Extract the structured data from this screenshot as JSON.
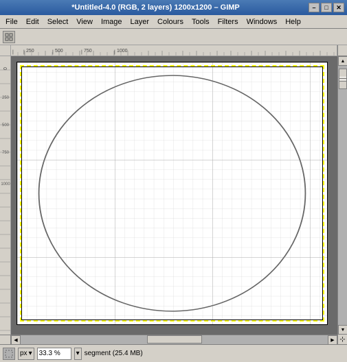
{
  "titlebar": {
    "title": "*Untitled-4.0 (RGB, 2 layers) 1200x1200 – GIMP",
    "minimize_label": "–",
    "maximize_label": "□",
    "close_label": "✕"
  },
  "menubar": {
    "items": [
      {
        "label": "File"
      },
      {
        "label": "Edit"
      },
      {
        "label": "Select"
      },
      {
        "label": "View"
      },
      {
        "label": "Image"
      },
      {
        "label": "Layer"
      },
      {
        "label": "Colours"
      },
      {
        "label": "Tools"
      },
      {
        "label": "Filters"
      },
      {
        "label": "Windows"
      },
      {
        "label": "Help"
      }
    ]
  },
  "statusbar": {
    "unit": "px",
    "zoom": "33.3 %",
    "info": "segment (25.4 MB)"
  },
  "canvas": {
    "grid_color": "#c8c8c8",
    "selection_color": "#ffff00",
    "circle_color": "#555555",
    "background": "#ffffff"
  },
  "scrollbar": {
    "up_arrow": "▲",
    "down_arrow": "▼",
    "left_arrow": "◀",
    "right_arrow": "▶",
    "resize_icon": "⊹"
  }
}
